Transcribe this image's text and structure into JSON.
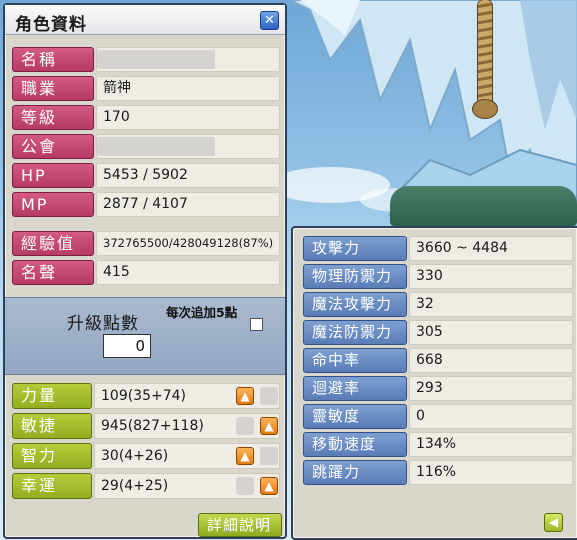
{
  "window": {
    "title": "角色資料",
    "close_icon": "close-icon"
  },
  "profile": [
    {
      "key": "name",
      "label": "名稱",
      "value": "",
      "empty": true
    },
    {
      "key": "job",
      "label": "職業",
      "value": "箭神",
      "empty": false
    },
    {
      "key": "level",
      "label": "等級",
      "value": "170",
      "empty": false
    },
    {
      "key": "guild",
      "label": "公會",
      "value": "",
      "empty": true
    },
    {
      "key": "hp",
      "label": "HP",
      "value": "5453 / 5902",
      "empty": false
    },
    {
      "key": "mp",
      "label": "MP",
      "value": "2877 / 4107",
      "empty": false
    },
    {
      "key": "exp",
      "label": "經驗值",
      "value": "372765500/428049128(87%)",
      "empty": false
    },
    {
      "key": "fame",
      "label": "名聲",
      "value": "415",
      "empty": false
    }
  ],
  "ability_points": {
    "label": "升級點數",
    "value": "0",
    "auto_assign_label": "每次追加5點",
    "auto_assign_checked": false
  },
  "stats": [
    {
      "key": "str",
      "label": "力量",
      "value": "109(35+74)",
      "up_icon": "arrow-up-icon"
    },
    {
      "key": "dex",
      "label": "敏捷",
      "value": "945(827+118)",
      "up_icon": "arrow-up-icon"
    },
    {
      "key": "int",
      "label": "智力",
      "value": "30(4+26)",
      "up_icon": "arrow-up-icon"
    },
    {
      "key": "luk",
      "label": "幸運",
      "value": "29(4+25)",
      "up_icon": "arrow-up-icon"
    }
  ],
  "detail_button": {
    "label": "詳細說明",
    "icon": "chevron-right-icon"
  },
  "detail_stats": [
    {
      "key": "attack",
      "label": "攻擊力",
      "value": "3660 ~ 4484"
    },
    {
      "key": "phys_def",
      "label": "物理防禦力",
      "value": "330"
    },
    {
      "key": "magic_atk",
      "label": "魔法攻擊力",
      "value": "32"
    },
    {
      "key": "magic_def",
      "label": "魔法防禦力",
      "value": "305"
    },
    {
      "key": "accuracy",
      "label": "命中率",
      "value": "668"
    },
    {
      "key": "avoid",
      "label": "迴避率",
      "value": "293"
    },
    {
      "key": "hands",
      "label": "靈敏度",
      "value": "0"
    },
    {
      "key": "speed",
      "label": "移動速度",
      "value": "134%"
    },
    {
      "key": "jump",
      "label": "跳躍力",
      "value": "116%"
    }
  ],
  "back_button": {
    "icon": "arrow-left-icon"
  },
  "colors": {
    "profile_label": "#c0466f",
    "stat_label": "#a3bc2c",
    "detail_label": "#6a8cc4",
    "up_button": "#f08a1e",
    "panel_bg": "#d9d6cc"
  }
}
